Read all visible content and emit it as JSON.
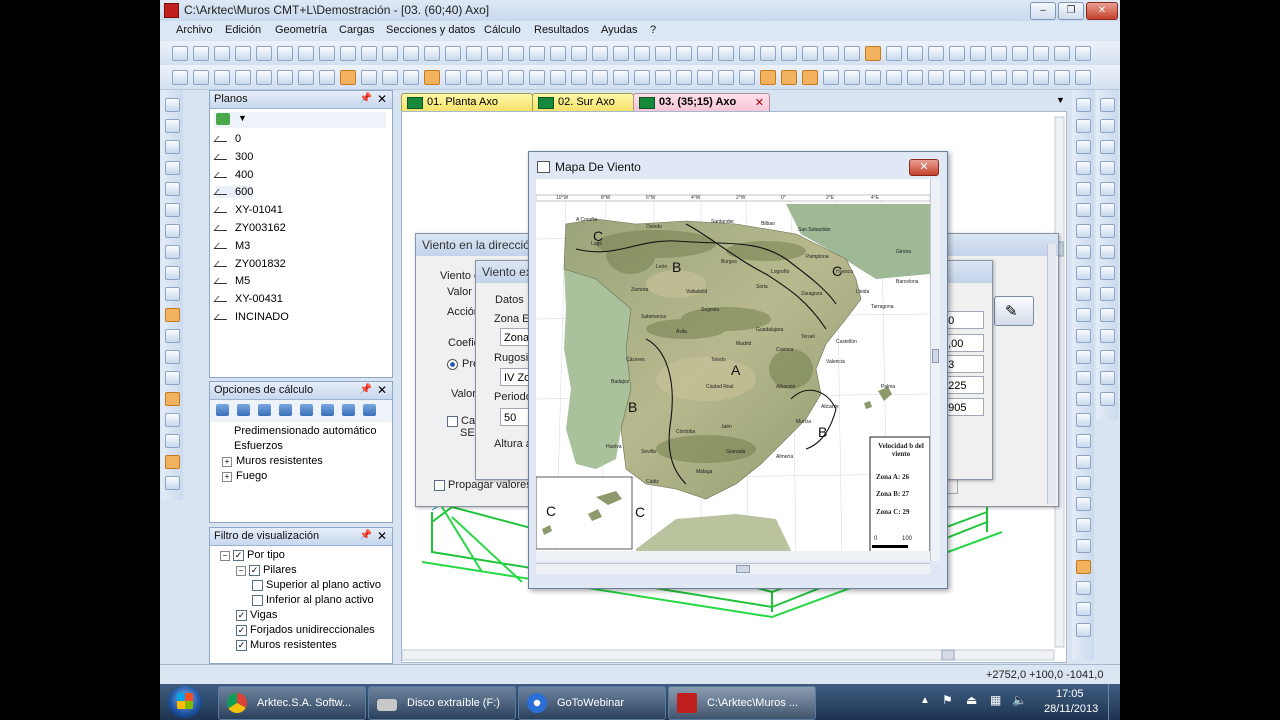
{
  "window": {
    "title": "C:\\Arktec\\Muros CMT+L\\Demostración - [03.  (60;40)  Axo]"
  },
  "menu": [
    "Archivo",
    "Edición",
    "Geometría",
    "Cargas",
    "Secciones y datos",
    "Cálculo",
    "Resultados",
    "Ayudas",
    "?"
  ],
  "panels": {
    "planos": {
      "title": "Planos",
      "items": [
        "0",
        "300",
        "400",
        "600",
        "XY-01041",
        "ZY003162",
        "M3",
        "ZY001832",
        "M5",
        "XY-00431",
        "INCINADO"
      ]
    },
    "opciones": {
      "title": "Opciones de cálculo",
      "items": [
        "Predimensionado automático",
        "Esfuerzos",
        "Muros resistentes",
        "Fuego"
      ]
    },
    "filtro": {
      "title": "Filtro de visualización",
      "items": [
        "Por tipo",
        "Pilares",
        "Superior al plano activo",
        "Inferior al plano activo",
        "Vigas",
        "Forjados unidireccionales",
        "Muros resistentes"
      ]
    }
  },
  "tabs": [
    "01. Planta   Axo",
    "02. Sur   Axo",
    "03.  (35;15)  Axo"
  ],
  "dialog_viento": {
    "title": "Viento en la dirección",
    "labels": [
      "Viento e",
      "Valor",
      "Acción",
      "Coefic",
      "Pre",
      "Valor",
      "Ca",
      "SE",
      "Propagar valores"
    ],
    "button_fragment": "ar",
    "values": [
      "00",
      "1,00",
      "63",
      "4225",
      "6905"
    ]
  },
  "dialog_viento_ext": {
    "title": "Viento ext",
    "labels": [
      "Datos",
      "Zona E",
      "Zona",
      "Rugosi",
      "IV Zo",
      "Periodo",
      "50",
      "Altura a"
    ]
  },
  "map_dialog": {
    "title": "Mapa De Viento",
    "close": "✕",
    "zones": [
      "A",
      "B",
      "B",
      "B",
      "C",
      "C",
      "C",
      "C"
    ],
    "legend": {
      "title": "Velocidad b del viento",
      "rows": [
        "Zona A: 26",
        "Zona B: 27",
        "Zona C: 29"
      ],
      "scale": [
        "0",
        "100"
      ]
    },
    "lon_ticks": [
      "10°W",
      "8°W",
      "6°W",
      "4°W",
      "2°W",
      "0°",
      "2°E",
      "4°E"
    ],
    "cities": [
      "A Coruña",
      "Santander",
      "Bilbao",
      "San Sebastián",
      "Oviedo",
      "Lugo",
      "Pamplona",
      "León",
      "Burgos",
      "Logroño",
      "Huesca",
      "Girona",
      "Zamora",
      "Valladolid",
      "Soria",
      "Zaragoza",
      "Lleida",
      "Barcelona",
      "Tarragona",
      "Salamanca",
      "Segovia",
      "Guadalajara",
      "Teruel",
      "Ávila",
      "Madrid",
      "Cuenca",
      "Castellón",
      "Cáceres",
      "Toledo",
      "Valencia",
      "Badajoz",
      "Ciudad Real",
      "Albacete",
      "Alicante",
      "Córdoba",
      "Jaén",
      "Murcia",
      "Huelva",
      "Sevilla",
      "Granada",
      "Almería",
      "Málaga",
      "Cádiz",
      "Palma"
    ]
  },
  "status": {
    "coords": "+2752,0  +100,0    -1041,0"
  },
  "taskbar": {
    "items": [
      "Arktec.S.A. Softw...",
      "Disco extraíble (F:)",
      "GoToWebinar",
      "C:\\Arktec\\Muros ..."
    ],
    "time": "17:05",
    "date": "28/11/2013"
  },
  "colors": {
    "accent_orange": "#f3b25f",
    "tab_yellow": "#f4e36b",
    "structure_green": "#1fc43a"
  }
}
